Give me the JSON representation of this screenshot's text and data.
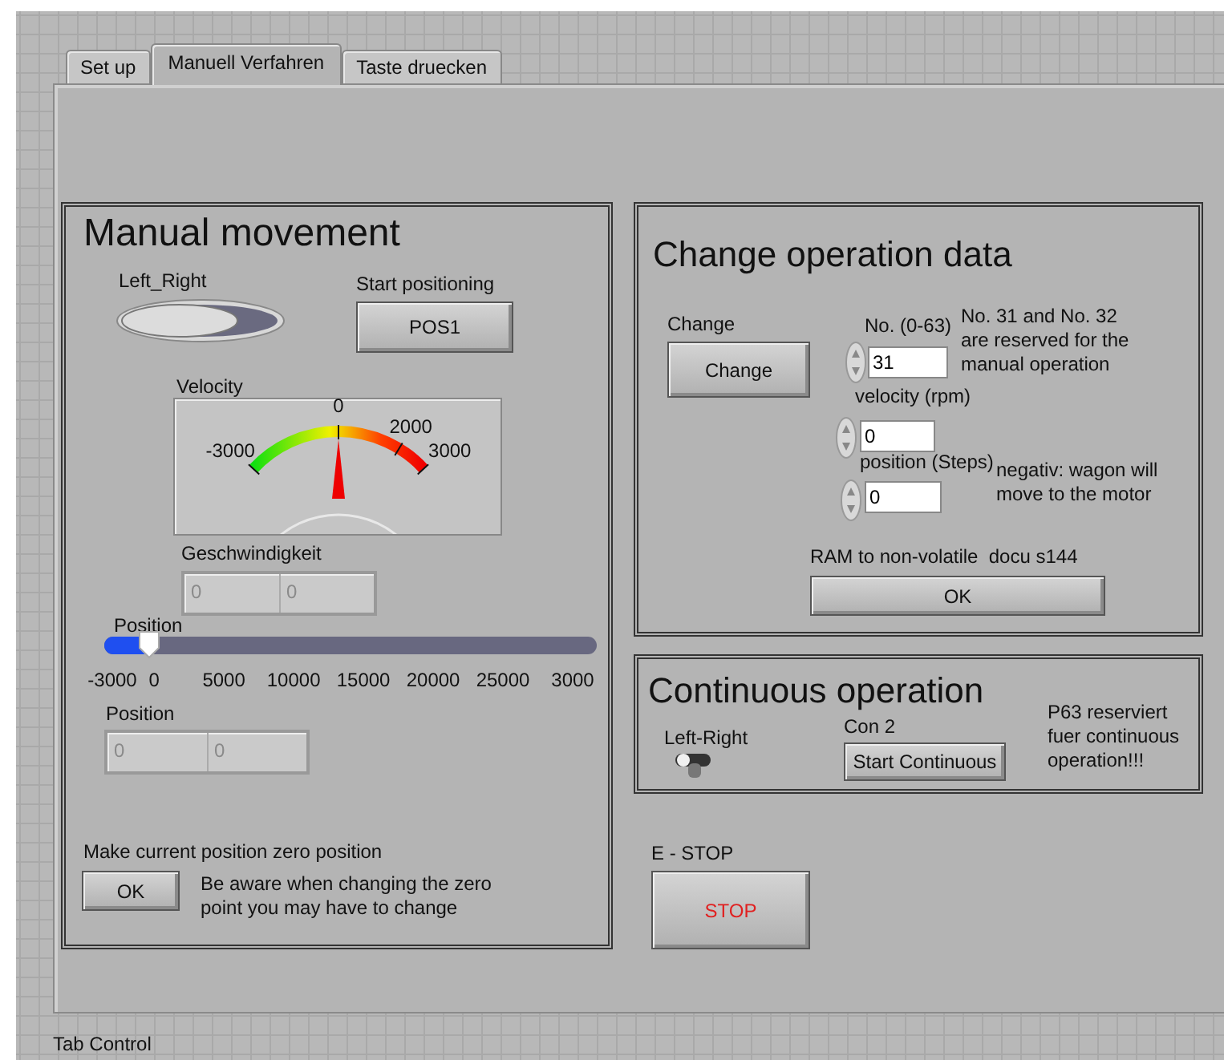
{
  "tabs": [
    {
      "label": "Set up",
      "selected": false
    },
    {
      "label": "Manuell Verfahren",
      "selected": true
    },
    {
      "label": "Taste druecken",
      "selected": false
    }
  ],
  "manual_movement": {
    "title": "Manual movement",
    "left_right": {
      "label": "Left_Right",
      "on": false
    },
    "start_positioning": {
      "label": "Start positioning",
      "button": "POS1"
    },
    "velocity_gauge": {
      "label": "Velocity",
      "level": 0.5,
      "scale": [
        "-3000",
        "0",
        "2000",
        "3000"
      ]
    },
    "geschwindigkeit": {
      "label": "Geschwindigkeit",
      "values": [
        "0",
        "0"
      ],
      "disabled": true
    },
    "position_slider": {
      "label": "Position",
      "level": 0.0909,
      "ticks": [
        "-3000",
        "0",
        "5000",
        "10000",
        "15000",
        "20000",
        "25000",
        "3000"
      ]
    },
    "position": {
      "label": "Position",
      "values": [
        "0",
        "0"
      ],
      "disabled": true
    },
    "zero": {
      "label": "Make current position zero position",
      "button": "OK",
      "note": "Be aware when changing the zero point you may have to change"
    }
  },
  "change_operation_data": {
    "title": "Change operation data",
    "change": {
      "label": "Change",
      "button": "Change"
    },
    "fields": [
      {
        "label": "No. (0-63)",
        "value": "31"
      },
      {
        "label": "velocity (rpm)",
        "value": "0"
      },
      {
        "label": "position (Steps)",
        "value": "0"
      }
    ],
    "reserved_note": "No. 31 and No. 32 are reserved for the manual operation",
    "negative_note": "negativ: wagon will move to the motor",
    "ram": {
      "label": "RAM to non-volatile  docu s144",
      "button": "OK"
    }
  },
  "continuous_operation": {
    "title": "Continuous operation",
    "left_right": {
      "label": "Left-Right",
      "on": false
    },
    "con": {
      "label": "Con 2",
      "button": "Start Continuous"
    },
    "note": "P63 reserviert fuer continuous operation!!!"
  },
  "e_stop": {
    "label": "E - STOP",
    "button": "STOP"
  },
  "tab_control_label": "Tab Control"
}
